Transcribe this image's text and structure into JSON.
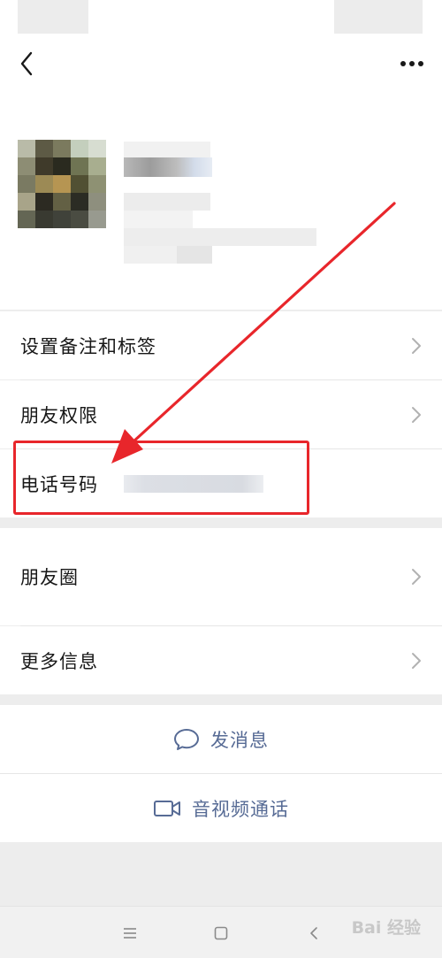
{
  "menu": {
    "remarks_label": "设置备注和标签",
    "permissions_label": "朋友权限",
    "phone_label": "电话号码",
    "moments_label": "朋友圈",
    "more_info_label": "更多信息"
  },
  "actions": {
    "message_label": "发消息",
    "call_label": "音视频通话"
  },
  "icons": {
    "back": "chevron-left-icon",
    "more": "more-dots-icon",
    "message": "chat-bubble-icon",
    "call": "video-camera-icon",
    "menu": "system-menu-icon",
    "home": "system-home-icon",
    "sys_back": "system-back-icon"
  },
  "colors": {
    "link": "#576b95",
    "annotation": "#e8262b",
    "background": "#ededed"
  },
  "watermark": {
    "text": "Bai 经验"
  }
}
